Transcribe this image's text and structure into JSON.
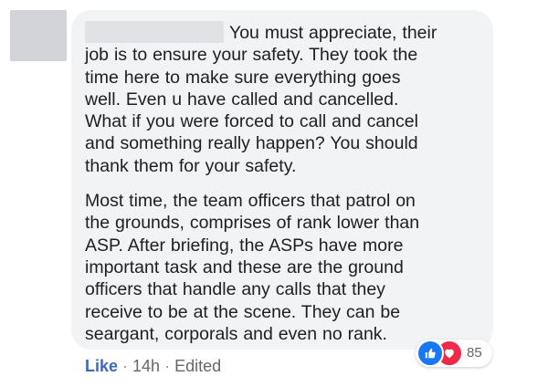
{
  "comment": {
    "author_redacted": true,
    "paragraph1": "You must appreciate, their\njob is to ensure your safety. They took the\ntime here to make sure everything goes\nwell. Even u have called and cancelled.\nWhat if you were forced to call and cancel\nand something really happen? You should\nthank them for your safety.",
    "paragraph2": "Most time, the team officers that patrol on\nthe grounds, comprises of rank lower than\nASP. After briefing, the ASPs have more\nimportant task and these are the ground\nofficers that handle any calls that they\nreceive to be at the scene. They can be\nseargant, corporals and even no rank."
  },
  "reactions": {
    "icons": [
      "like-icon",
      "love-icon"
    ],
    "count": "85",
    "colors": {
      "like": "#1877f2",
      "love": "#f0284a"
    }
  },
  "actions": {
    "like_label": "Like",
    "separator": "·",
    "timestamp": "14h",
    "edited_label": "Edited"
  }
}
